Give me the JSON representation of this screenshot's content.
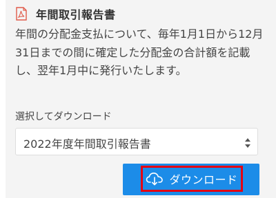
{
  "section": {
    "title": "年間取引報告書",
    "title_icon": "pdf-icon",
    "description": "年間の分配金支払について、毎年1月1日から12月31日までの間に確定した分配金の合計額を記載し、翌年1月中に発行いたします。"
  },
  "download": {
    "select_label": "選択してダウンロード",
    "selected_option": "2022年度年間取引報告書",
    "button_label": "ダウンロード",
    "button_icon": "cloud-download-icon"
  },
  "colors": {
    "accent": "#1c8ce8",
    "highlight": "#e60012",
    "pdf_icon": "#e05a4a",
    "card_bg": "#f4f4f4"
  }
}
